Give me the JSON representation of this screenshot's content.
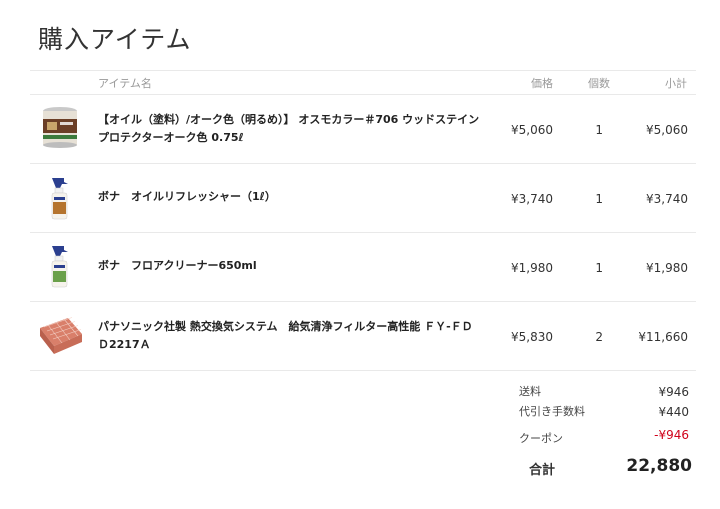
{
  "title": "購入アイテム",
  "headers": {
    "item": "アイテム名",
    "price": "価格",
    "qty": "個数",
    "subtotal": "小計"
  },
  "items": [
    {
      "name": "【オイル（塗料）/オーク色（明るめ）】 オスモカラー＃706 ウッドステインプロテクターオーク色 0.75ℓ",
      "price": "¥5,060",
      "qty": "1",
      "subtotal": "¥5,060",
      "thumb_icon": "paint-can-icon"
    },
    {
      "name": "ボナ　オイルリフレッシャー（1ℓ）",
      "price": "¥3,740",
      "qty": "1",
      "subtotal": "¥3,740",
      "thumb_icon": "spray-bottle-icon"
    },
    {
      "name": "ボナ　フロアクリーナー650ml",
      "price": "¥1,980",
      "qty": "1",
      "subtotal": "¥1,980",
      "thumb_icon": "spray-bottle-icon"
    },
    {
      "name": "パナソニック社製 熱交換気システム　給気清浄フィルター高性能 ＦＹ-ＦＤＤ2217Ａ",
      "price": "¥5,830",
      "qty": "2",
      "subtotal": "¥11,660",
      "thumb_icon": "filter-icon"
    }
  ],
  "summary": {
    "shipping_label": "送料",
    "shipping": "¥946",
    "cod_label": "代引き手数料",
    "cod": "¥440",
    "coupon_label": "クーポン",
    "coupon": "-¥946",
    "total_label": "合計",
    "total": "22,880"
  },
  "colors": {
    "coupon": "#d0021b",
    "divider": "#e9e9e9"
  }
}
